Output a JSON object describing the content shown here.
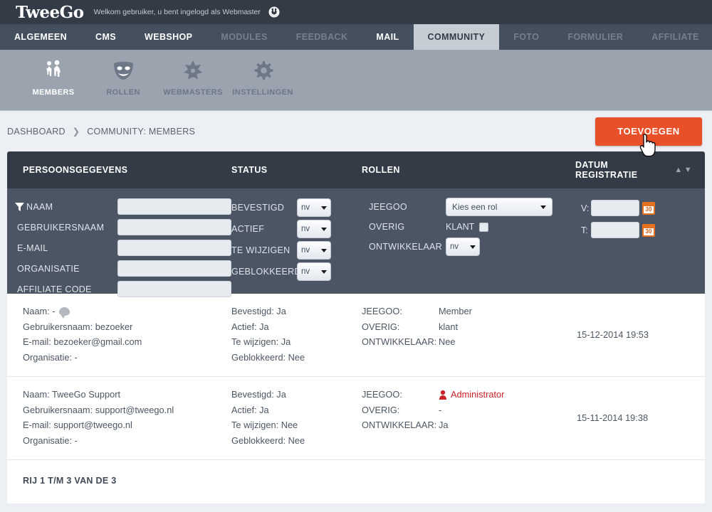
{
  "header": {
    "logo": "TweeGo",
    "welcome": "Welkom gebruiker, u bent ingelogd als Webmaster",
    "power_icon": "power-icon"
  },
  "mainnav": {
    "tabs": [
      {
        "label": "ALGEMEEN",
        "state": "normal"
      },
      {
        "label": "CMS",
        "state": "normal"
      },
      {
        "label": "WEBSHOP",
        "state": "normal"
      },
      {
        "label": "MODULES",
        "state": "dim"
      },
      {
        "label": "FEEDBACK",
        "state": "dim"
      },
      {
        "label": "MAIL",
        "state": "normal"
      },
      {
        "label": "COMMUNITY",
        "state": "active"
      },
      {
        "label": "FOTO",
        "state": "dim"
      },
      {
        "label": "FORMULIER",
        "state": "dim"
      },
      {
        "label": "AFFILIATE",
        "state": "dim"
      }
    ],
    "more_arrow": "❯"
  },
  "subnav": {
    "items": [
      {
        "label": "MEMBERS",
        "icon": "people-icon",
        "active": true
      },
      {
        "label": "ROLLEN",
        "icon": "mask-icon",
        "active": false
      },
      {
        "label": "WEBMASTERS",
        "icon": "sheriff-star-icon",
        "active": false
      },
      {
        "label": "INSTELLINGEN",
        "icon": "gear-icon",
        "active": false
      }
    ]
  },
  "breadcrumb": {
    "root": "DASHBOARD",
    "separator": "❯",
    "current": "COMMUNITY: MEMBERS"
  },
  "toolbar": {
    "add_label": "TOEVOEGEN",
    "add_color": "#e8502a"
  },
  "table": {
    "columns": {
      "personal": "PERSOONSGEGEVENS",
      "status": "STATUS",
      "roles": "ROLLEN",
      "date": "DATUM REGISTRATIE"
    },
    "sort_asc": "▲",
    "sort_desc": "▼"
  },
  "filters": {
    "filter_icon": "funnel-icon",
    "text_fields": [
      {
        "label": "NAAM",
        "value": "",
        "has_filter_icon": true
      },
      {
        "label": "GEBRUIKERSNAAM",
        "value": "",
        "has_filter_icon": false
      },
      {
        "label": "E-MAIL",
        "value": "",
        "has_filter_icon": false
      },
      {
        "label": "ORGANISATIE",
        "value": "",
        "has_filter_icon": false
      },
      {
        "label": "AFFILIATE CODE",
        "value": "",
        "has_filter_icon": false
      }
    ],
    "status_selects": [
      {
        "label": "BEVESTIGD",
        "value": "nv"
      },
      {
        "label": "ACTIEF",
        "value": "nv"
      },
      {
        "label": "TE WIJZIGEN",
        "value": "nv"
      },
      {
        "label": "GEBLOKKEERD",
        "value": "nv"
      }
    ],
    "roles": {
      "jeegoo_label": "JEEGOO",
      "jeegoo_value": "Kies een rol",
      "overig_label": "OVERIG",
      "klant_label": "KLANT",
      "klant_checked": false,
      "ontwikkelaar_label": "ONTWIKKELAAR",
      "ontwikkelaar_value": "nv"
    },
    "dates": {
      "from_label": "V:",
      "from_value": "",
      "to_label": "T:",
      "to_value": "",
      "calendar_icon_day": "30"
    }
  },
  "rows": [
    {
      "naam": "Naam: -",
      "has_comment_icon": true,
      "gebruikersnaam": "Gebruikersnaam: bezoeker",
      "email": "E-mail: bezoeker@gmail.com",
      "organisatie": "Organisatie: -",
      "bevestigd": "Bevestigd: Ja",
      "actief": "Actief: Ja",
      "te_wijzigen": "Te wijzigen: Ja",
      "geblokkeerd": "Geblokkeerd: Nee",
      "jeegoo_label": "JEEGOO:",
      "jeegoo_value": "Member",
      "jeegoo_is_admin": false,
      "overig_label": "OVERIG:",
      "overig_value": "klant",
      "ontwikkelaar_label": "ONTWIKKELAAR:",
      "ontwikkelaar_value": "Nee",
      "datum": "15-12-2014 19:53"
    },
    {
      "naam": "Naam: TweeGo Support",
      "has_comment_icon": false,
      "gebruikersnaam": "Gebruikersnaam: support@tweego.nl",
      "email": "E-mail: support@tweego.nl",
      "organisatie": "Organisatie: -",
      "bevestigd": "Bevestigd: Ja",
      "actief": "Actief: Ja",
      "te_wijzigen": "Te wijzigen: Nee",
      "geblokkeerd": "Geblokkeerd: Nee",
      "jeegoo_label": "JEEGOO:",
      "jeegoo_value": "Administrator",
      "jeegoo_is_admin": true,
      "overig_label": "OVERIG:",
      "overig_value": "-",
      "ontwikkelaar_label": "ONTWIKKELAAR:",
      "ontwikkelaar_value": "Ja",
      "datum": "15-11-2014 19:38"
    }
  ],
  "footer": {
    "count_label": "RIJ 1 T/M 3 VAN DE 3"
  }
}
